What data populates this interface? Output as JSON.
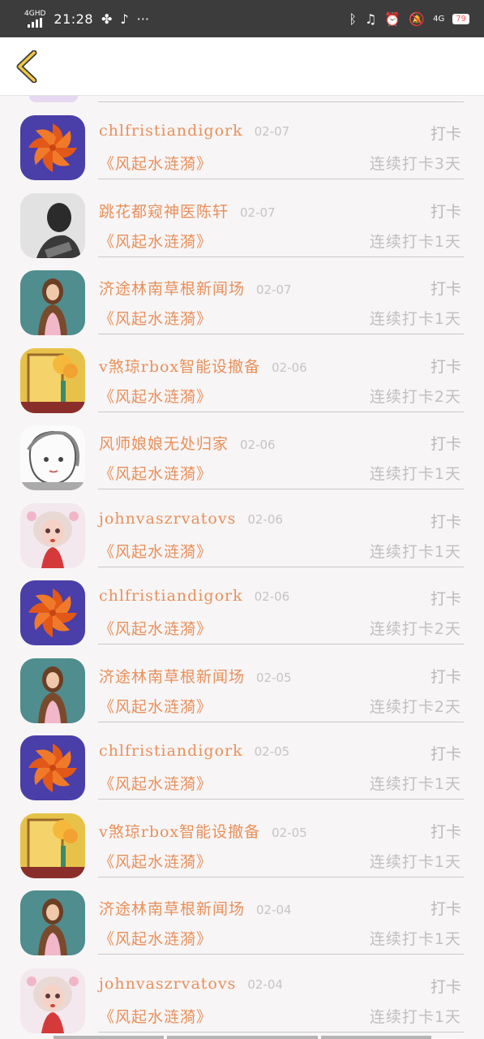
{
  "status_bar": {
    "network": "4GHD",
    "time": "21:28",
    "battery": "79",
    "icons_left": [
      "signal-icon",
      "fan-icon",
      "tiktok-icon",
      "more-dots-icon"
    ],
    "icons_right": [
      "bluetooth-icon",
      "headphones-icon",
      "alarm-icon",
      "mute-icon",
      "4g-icon",
      "battery-icon"
    ]
  },
  "header": {
    "back_icon": "chevron-left-icon"
  },
  "colors": {
    "accent": "#e8905a",
    "muted": "#c0c0c0",
    "divider": "#c9c9c9"
  },
  "items": [
    {
      "name": "chlfristiandigork",
      "date": "02-07",
      "type": "打卡",
      "book": "《风起水涟漪》",
      "streak": "连续打卡3天",
      "avatar": "orange-pinwheel"
    },
    {
      "name": "跳花都窥神医陈轩",
      "date": "02-07",
      "type": "打卡",
      "book": "《风起水涟漪》",
      "streak": "连续打卡1天",
      "avatar": "bw-man"
    },
    {
      "name": "济途林南草根新闻场",
      "date": "02-07",
      "type": "打卡",
      "book": "《风起水涟漪》",
      "streak": "连续打卡1天",
      "avatar": "woman-teal"
    },
    {
      "name": "v煞琼rbox智能设撤备",
      "date": "02-06",
      "type": "打卡",
      "book": "《风起水涟漪》",
      "streak": "连续打卡2天",
      "avatar": "yellow-room"
    },
    {
      "name": "风师娘娘无处归家",
      "date": "02-06",
      "type": "打卡",
      "book": "《风起水涟漪》",
      "streak": "连续打卡1天",
      "avatar": "sketch-girl"
    },
    {
      "name": "johnvaszrvatovs",
      "date": "02-06",
      "type": "打卡",
      "book": "《风起水涟漪》",
      "streak": "连续打卡1天",
      "avatar": "doll-girl"
    },
    {
      "name": "chlfristiandigork",
      "date": "02-06",
      "type": "打卡",
      "book": "《风起水涟漪》",
      "streak": "连续打卡2天",
      "avatar": "orange-pinwheel"
    },
    {
      "name": "济途林南草根新闻场",
      "date": "02-05",
      "type": "打卡",
      "book": "《风起水涟漪》",
      "streak": "连续打卡2天",
      "avatar": "woman-teal"
    },
    {
      "name": "chlfristiandigork",
      "date": "02-05",
      "type": "打卡",
      "book": "《风起水涟漪》",
      "streak": "连续打卡1天",
      "avatar": "orange-pinwheel"
    },
    {
      "name": "v煞琼rbox智能设撤备",
      "date": "02-05",
      "type": "打卡",
      "book": "《风起水涟漪》",
      "streak": "连续打卡1天",
      "avatar": "yellow-room"
    },
    {
      "name": "济途林南草根新闻场",
      "date": "02-04",
      "type": "打卡",
      "book": "《风起水涟漪》",
      "streak": "连续打卡1天",
      "avatar": "woman-teal"
    },
    {
      "name": "johnvaszrvatovs",
      "date": "02-04",
      "type": "打卡",
      "book": "《风起水涟漪》",
      "streak": "连续打卡1天",
      "avatar": "doll-girl"
    }
  ]
}
